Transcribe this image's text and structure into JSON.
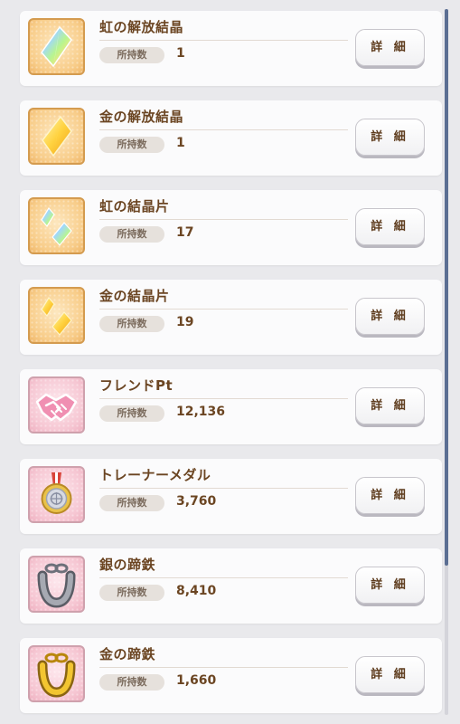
{
  "owned_label": "所持数",
  "detail_label": "詳 細",
  "items": [
    {
      "name": "虹の解放結晶",
      "count": "1",
      "icon": "rainbow-crystal-icon"
    },
    {
      "name": "金の解放結晶",
      "count": "1",
      "icon": "gold-crystal-icon"
    },
    {
      "name": "虹の結晶片",
      "count": "17",
      "icon": "rainbow-shards-icon"
    },
    {
      "name": "金の結晶片",
      "count": "19",
      "icon": "gold-shards-icon"
    },
    {
      "name": "フレンドPt",
      "count": "12,136",
      "icon": "handshake-icon"
    },
    {
      "name": "トレーナーメダル",
      "count": "3,760",
      "icon": "medal-icon"
    },
    {
      "name": "銀の蹄鉄",
      "count": "8,410",
      "icon": "silver-horseshoe-icon"
    },
    {
      "name": "金の蹄鉄",
      "count": "1,660",
      "icon": "gold-horseshoe-icon"
    }
  ],
  "colors": {
    "text_brown": "#6b4522",
    "gold_frame": "#f8cd8a",
    "pink_frame": "#f6c7d3",
    "scroll_thumb": "#5b6e93"
  }
}
